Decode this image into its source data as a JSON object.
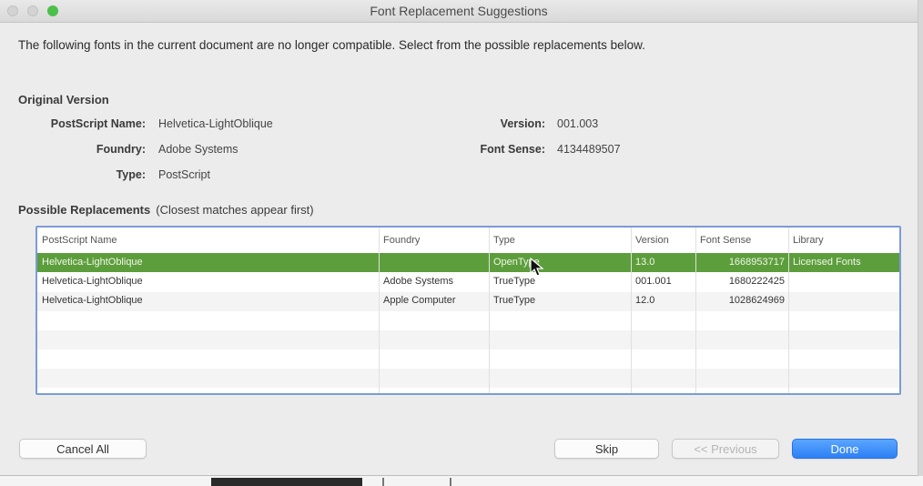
{
  "window": {
    "title": "Font Replacement Suggestions"
  },
  "intro": "The following fonts in the current document are no longer compatible. Select from the possible replacements below.",
  "original": {
    "heading": "Original Version",
    "postscript_label": "PostScript Name:",
    "postscript_value": "Helvetica-LightOblique",
    "foundry_label": "Foundry:",
    "foundry_value": "Adobe Systems",
    "type_label": "Type:",
    "type_value": "PostScript",
    "version_label": "Version:",
    "version_value": "001.003",
    "fontsense_label": "Font Sense:",
    "fontsense_value": "4134489507"
  },
  "replacements": {
    "heading": "Possible Replacements",
    "note": "(Closest matches appear first)",
    "columns": [
      "PostScript Name",
      "Foundry",
      "Type",
      "Version",
      "Font Sense",
      "Library"
    ],
    "rows": [
      {
        "name": "Helvetica-LightOblique",
        "foundry": "",
        "type": "OpenType",
        "version": "13.0",
        "fontsense": "1668953717",
        "library": "Licensed Fonts",
        "selected": true
      },
      {
        "name": "Helvetica-LightOblique",
        "foundry": "Adobe Systems",
        "type": "TrueType",
        "version": "001.001",
        "fontsense": "1680222425",
        "library": "",
        "selected": false
      },
      {
        "name": "Helvetica-LightOblique",
        "foundry": "Apple Computer",
        "type": "TrueType",
        "version": "12.0",
        "fontsense": "1028624969",
        "library": "",
        "selected": false
      }
    ]
  },
  "buttons": {
    "cancel_all": "Cancel All",
    "skip": "Skip",
    "previous": "<< Previous",
    "done": "Done"
  },
  "colors": {
    "selection": "#5d9e3c",
    "primary_button": "#2d7ff5",
    "table_focus_border": "#7b9cd6"
  }
}
